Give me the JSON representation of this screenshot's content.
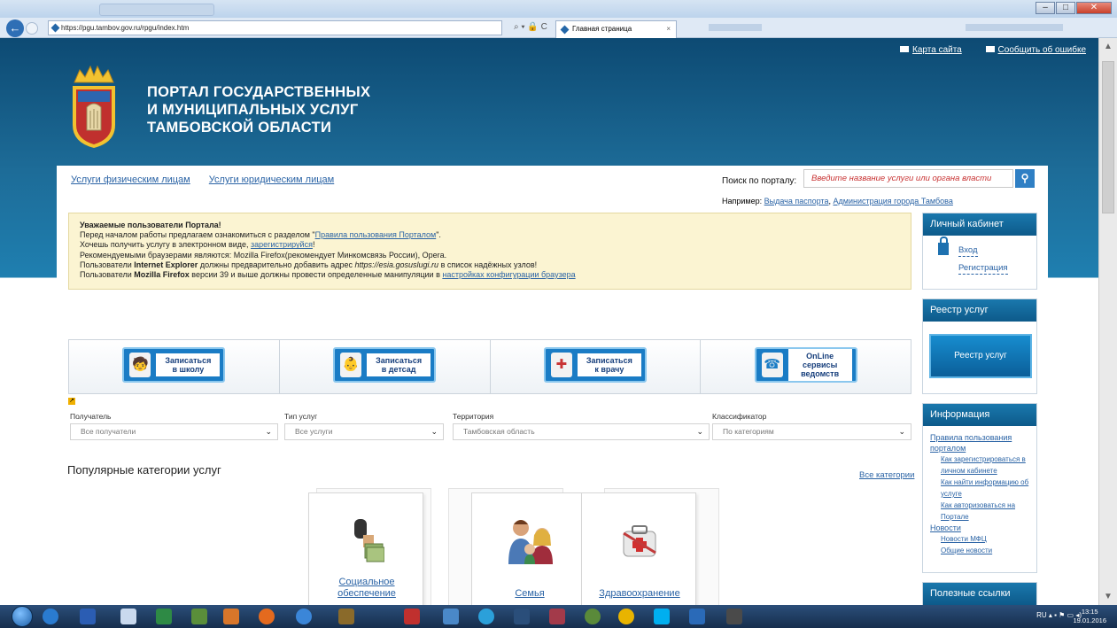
{
  "browser": {
    "url": "https://pgu.tambov.gov.ru/rpgu/index.htm",
    "tab_title": "Главная страница",
    "tab_close": "×",
    "addr_tools": "⌕ ▾ 🔒 C",
    "back_glyph": "←"
  },
  "header": {
    "sitemap": "Карта сайта",
    "report_error": "Сообщить об ошибке",
    "portal_line1": "ПОРТАЛ ГОСУДАРСТВЕННЫХ",
    "portal_line2": "И МУНИЦИПАЛЬНЫХ УСЛУГ",
    "portal_line3": "ТАМБОВСКОЙ ОБЛАСТИ"
  },
  "services_nav": {
    "individuals": "Услуги физическим лицам",
    "legal": "Услуги юридическим лицам"
  },
  "search": {
    "label": "Поиск по порталу:",
    "placeholder": "Введите название услуги или органа власти",
    "example_label": "Например:",
    "example1": "Выдача паспорта",
    "example_sep": ",",
    "example2": "Администрация города Тамбова"
  },
  "notice": {
    "title": "Уважаемые пользователи Портала!",
    "l1a": "Перед началом работы предлагаем ознакомиться с разделом \"",
    "l1link": "Правила пользования Порталом",
    "l1b": "\".",
    "l2a": "Хочешь получить услугу в электронном виде,",
    "l2link": "зарегистрируйся",
    "l2b": "!",
    "l3": "Рекомендуемыми браузерами являются: Mozilla Firefox(рекомендует Минкомсвязь России), Opera.",
    "l4a": "Пользователи",
    "l4b": "Internet Explorer",
    "l4c": "должны предварительно добавить адрес",
    "l4d": "https://esia.gosuslugi.ru",
    "l4e": "в список надёжных узлов!",
    "l5a": "Пользователи",
    "l5b": "Mozilla Firefox",
    "l5c": "версии 39 и выше должны провести определенные манипуляции в",
    "l5link": "настройках конфигурации браузера"
  },
  "cabinet": {
    "title": "Личный кабинет",
    "login": "Вход",
    "register": "Регистрация"
  },
  "registry": {
    "title": "Реестр услуг",
    "button": "Реестр услуг"
  },
  "information": {
    "title": "Информация",
    "rules": "Правила пользования порталом",
    "how_register": "Как зарегистрироваться в личном кабинете",
    "how_find": "Как найти информацию об услуге",
    "how_auth": "Как авторизоваться на Портале",
    "news": "Новости",
    "news_mfc": "Новости МФЦ",
    "news_general": "Общие новости"
  },
  "useful": {
    "title": "Полезные ссылки"
  },
  "quick": [
    {
      "line1": "Записаться",
      "line2": "в школу",
      "icon": "🧒"
    },
    {
      "line1": "Записаться",
      "line2": "в детсад",
      "icon": "👶"
    },
    {
      "line1": "Записаться",
      "line2": "к врачу",
      "icon": "✚"
    },
    {
      "line1": "OnLine сервисы",
      "line2": "ведомств",
      "icon": "☎"
    }
  ],
  "filters": {
    "recipient_label": "Получатель",
    "recipient_value": "Все получатели",
    "type_label": "Тип услуг",
    "type_value": "Все услуги",
    "territory_label": "Территория",
    "territory_value": "Тамбовская область",
    "classifier_label": "Классификатор",
    "classifier_value": "По категориям",
    "caret": "⌄"
  },
  "popular": {
    "title": "Популярные категории услуг",
    "all": "Все категории",
    "cards": [
      {
        "label": "Социальное обеспечение"
      },
      {
        "label": "Семья"
      },
      {
        "label": "Здравоохранение"
      }
    ]
  },
  "taskbar": {
    "lang": "RU",
    "time": "13:15",
    "date": "19.01.2016"
  }
}
